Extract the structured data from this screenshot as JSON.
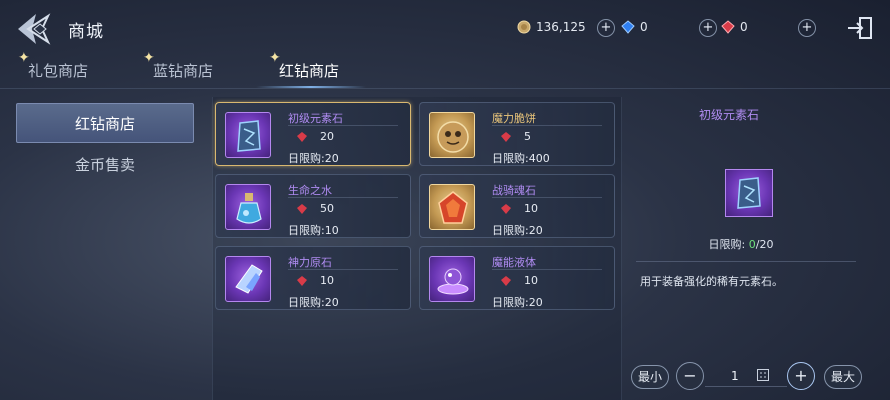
{
  "header": {
    "title": "商城",
    "gold": "136,125",
    "blue_diamond": "0",
    "red_diamond": "0"
  },
  "tabs": [
    {
      "label": "礼包商店"
    },
    {
      "label": "蓝钻商店"
    },
    {
      "label": "红钻商店"
    }
  ],
  "sidebar": {
    "items": [
      {
        "label": "红钻商店"
      },
      {
        "label": "金币售卖"
      }
    ]
  },
  "items": [
    {
      "name": "初级元素石",
      "price": "20",
      "limit": "日限购:20",
      "icon": "element-stone-icon"
    },
    {
      "name": "魔力脆饼",
      "price": "5",
      "limit": "日限购:400",
      "icon": "magic-biscuit-icon"
    },
    {
      "name": "生命之水",
      "price": "50",
      "limit": "日限购:10",
      "icon": "life-water-icon"
    },
    {
      "name": "战骑魂石",
      "price": "10",
      "limit": "日限购:20",
      "icon": "mount-soulstone-icon"
    },
    {
      "name": "神力原石",
      "price": "10",
      "limit": "日限购:20",
      "icon": "divine-ore-icon"
    },
    {
      "name": "魔能液体",
      "price": "10",
      "limit": "日限购:20",
      "icon": "mana-liquid-icon"
    }
  ],
  "detail": {
    "title": "初级元素石",
    "limit_label": "日限购: ",
    "limit_current": "0",
    "limit_max": "/20",
    "description": "用于装备强化的稀有元素石。"
  },
  "quantity": {
    "min_label": "最小",
    "max_label": "最大",
    "value": "1"
  },
  "colors": {
    "rarity_purple": "#b08cf2",
    "rarity_gold": "#e8c47a",
    "selected_border": "#d9b870",
    "limit_green": "#6fe07d"
  }
}
